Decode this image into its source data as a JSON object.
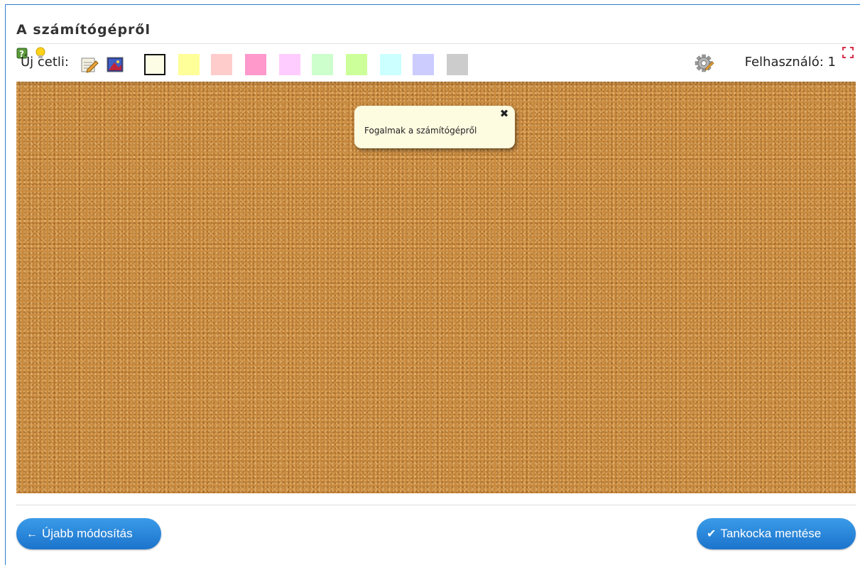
{
  "page_title": "A számítógépről",
  "toolbar": {
    "new_note_label": "Új cetli:",
    "swatch_colors": [
      "#fdfde6",
      "#ffff99",
      "#ffcccc",
      "#ff99cc",
      "#ffccff",
      "#ccffcc",
      "#ccff99",
      "#ccffff",
      "#ccccff",
      "#cccccc"
    ],
    "selected_swatch": 0,
    "user_label": "Felhasználó: 1"
  },
  "board": {
    "background": "cork",
    "notes": [
      {
        "text": "Fogalmak a számítógépről",
        "color": "#fdfbe0"
      }
    ]
  },
  "buttons": {
    "back_label": "Újabb módosítás",
    "save_label": "Tankocka mentése"
  },
  "colors": {
    "accent": "#1c74cc",
    "cork": "#c98a3e"
  }
}
